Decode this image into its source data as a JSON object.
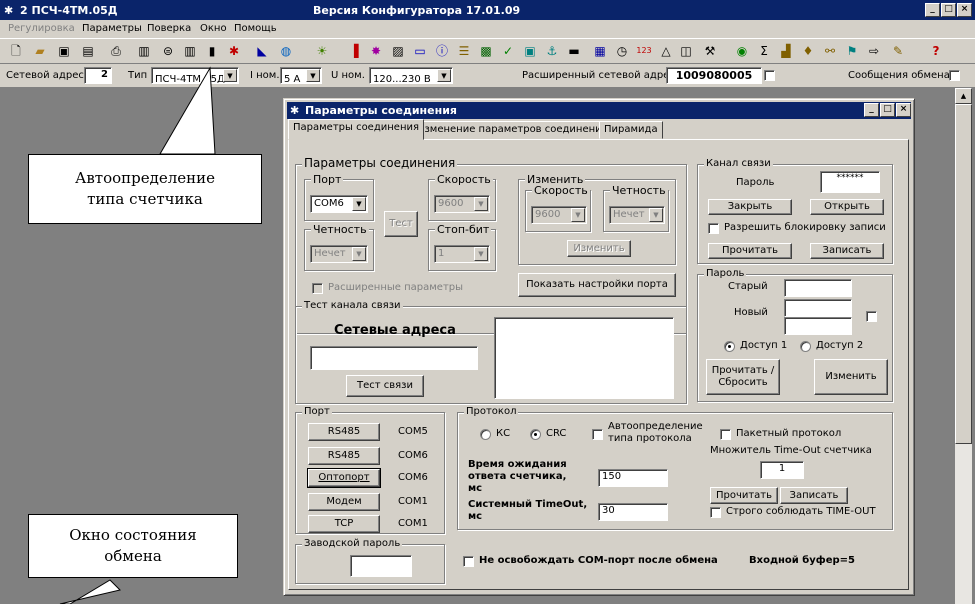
{
  "app": {
    "title": "2 ПСЧ-4ТМ.05Д",
    "version": "Версия Конфигуратора  17.01.09",
    "win_min": "_",
    "win_max": "□",
    "win_close": "×"
  },
  "menu": [
    "Регулировка",
    "Параметры",
    "Поверка",
    "Окно",
    "Помощь"
  ],
  "addrbar": {
    "net_addr_label": "Сетевой адрес",
    "net_addr_value": "2",
    "type_label": "Тип",
    "type_value": "ПСЧ-4ТМ.05Д",
    "inom_label": "I ном.",
    "inom_value": "5 А",
    "unom_label": "U ном.",
    "unom_value": "120...230 В",
    "ext_addr_label": "Расширенный сетевой адрес",
    "ext_addr_value": "1009080005",
    "exchange_msgs_label": "Сообщения обмена"
  },
  "dialog": {
    "title": "Параметры соединения",
    "tabs": [
      "Параметры соединения",
      "Изменение параметров соединения",
      "Пирамида"
    ],
    "conn_params": {
      "group_label": "Параметры соединения",
      "port_label": "Порт",
      "port_value": "COM6",
      "speed_label": "Скорость",
      "speed_value": "9600",
      "parity_label": "Четность",
      "parity_value": "Нечет",
      "stopbit_label": "Стоп-бит",
      "stopbit_value": "1",
      "test_btn": "Тест",
      "change_group": "Изменить",
      "change_speed_label": "Скорость",
      "change_speed_value": "9600",
      "change_parity_label": "Четность",
      "change_parity_value": "Нечет",
      "change_btn": "Изменить",
      "ext_params": "Расширенные параметры",
      "show_port_btn": "Показать настройки порта"
    },
    "channel": {
      "group_label": "Канал связи",
      "password_label": "Пароль",
      "password_value": "******",
      "close_btn": "Закрыть",
      "open_btn": "Открыть",
      "allow_lock": "Разрешить блокировку записи",
      "read_btn": "Прочитать",
      "write_btn": "Записать"
    },
    "password": {
      "group_label": "Пароль",
      "old_label": "Старый",
      "new_label": "Новый",
      "access1": "Доступ 1",
      "access2": "Доступ 2",
      "read_reset_btn": "Прочитать / Сбросить",
      "change_btn": "Изменить"
    },
    "test": {
      "group_label": "Тест канала связи",
      "net_addrs_label": "Сетевые адреса",
      "test_btn": "Тест связи"
    },
    "port": {
      "group_label": "Порт",
      "rows": [
        {
          "btn": "RS485",
          "com": "COM5"
        },
        {
          "btn": "RS485",
          "com": "COM6"
        },
        {
          "btn": "Оптопорт",
          "com": "COM6"
        },
        {
          "btn": "Модем",
          "com": "COM1"
        },
        {
          "btn": "TCP",
          "com": "COM1"
        }
      ]
    },
    "factory": {
      "group_label": "Заводской пароль"
    },
    "protocol": {
      "group_label": "Протокол",
      "ks": "КС",
      "crc": "CRC",
      "auto_detect": "Автоопределение типа протокола",
      "packet": "Пакетный протокол",
      "timeout_mult_label": "Множитель Time-Out счетчика",
      "timeout_mult_value": "1",
      "wait_label": "Время ожидания ответа счетчика, мс",
      "wait_value": "150",
      "sys_timeout_label": "Системный TimeOut, мс",
      "sys_timeout_value": "30",
      "read_btn": "Прочитать",
      "write_btn": "Записать",
      "strict_timeout": "Строго соблюдать TIME-OUT"
    },
    "no_release": "Не освобождать COM-порт после обмена",
    "input_buffer": "Входной буфер=5"
  },
  "callouts": {
    "auto_detect": "Автоопределение типа счетчика",
    "exchange_window": "Окно состояния обмена"
  },
  "help_icon": "?"
}
